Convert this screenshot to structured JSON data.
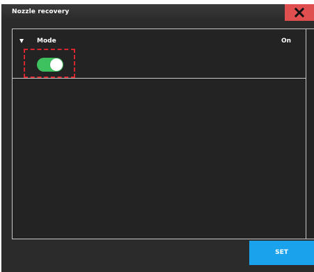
{
  "window": {
    "title": "Nozzle recovery"
  },
  "setting": {
    "label": "Mode",
    "value": "On",
    "enabled": true
  },
  "actions": {
    "set_label": "SET"
  },
  "icons": {
    "close": "close-icon",
    "expand": "chevron-down-icon"
  },
  "colors": {
    "close_bg": "#e04f4f",
    "toggle_on": "#3ec15f",
    "set_bg": "#1aa3ec",
    "focus_outline": "#d7262f"
  }
}
